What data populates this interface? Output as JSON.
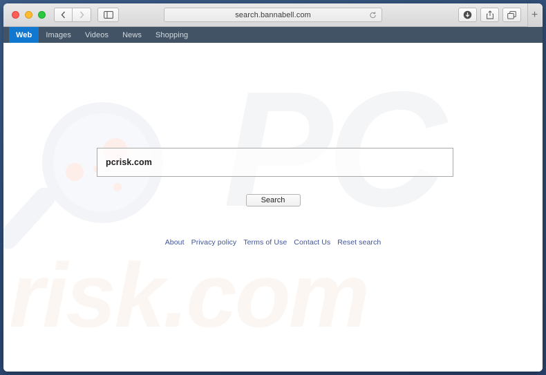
{
  "browser": {
    "traffic_lights": [
      "close",
      "minimize",
      "maximize"
    ],
    "back_label": "‹",
    "forward_label": "›",
    "sidebar_icon": "sidebar-icon",
    "url": "search.bannabell.com",
    "reload_icon": "reload-icon",
    "downloads_icon": "downloads-icon",
    "share_icon": "share-icon",
    "tabs_icon": "tab-overview-icon",
    "new_tab_label": "+"
  },
  "site_nav": {
    "items": [
      {
        "label": "Web",
        "active": true
      },
      {
        "label": "Images",
        "active": false
      },
      {
        "label": "Videos",
        "active": false
      },
      {
        "label": "News",
        "active": false
      },
      {
        "label": "Shopping",
        "active": false
      }
    ]
  },
  "search": {
    "query": "pcrisk.com",
    "placeholder": "",
    "button_label": "Search"
  },
  "footer": {
    "links": [
      "About",
      "Privacy policy",
      "Terms of Use",
      "Contact Us",
      "Reset search"
    ]
  },
  "watermarks": {
    "top_text": "PC",
    "bottom_text": "risk.com",
    "magnifier": "magnifier-icon"
  },
  "colors": {
    "nav_bar": "#415364",
    "nav_active": "#1277ce",
    "link": "#3f5396",
    "desktop": "#2f4d77",
    "watermark_gray": "#f4f5f7",
    "watermark_peach": "#fcf6f3"
  }
}
